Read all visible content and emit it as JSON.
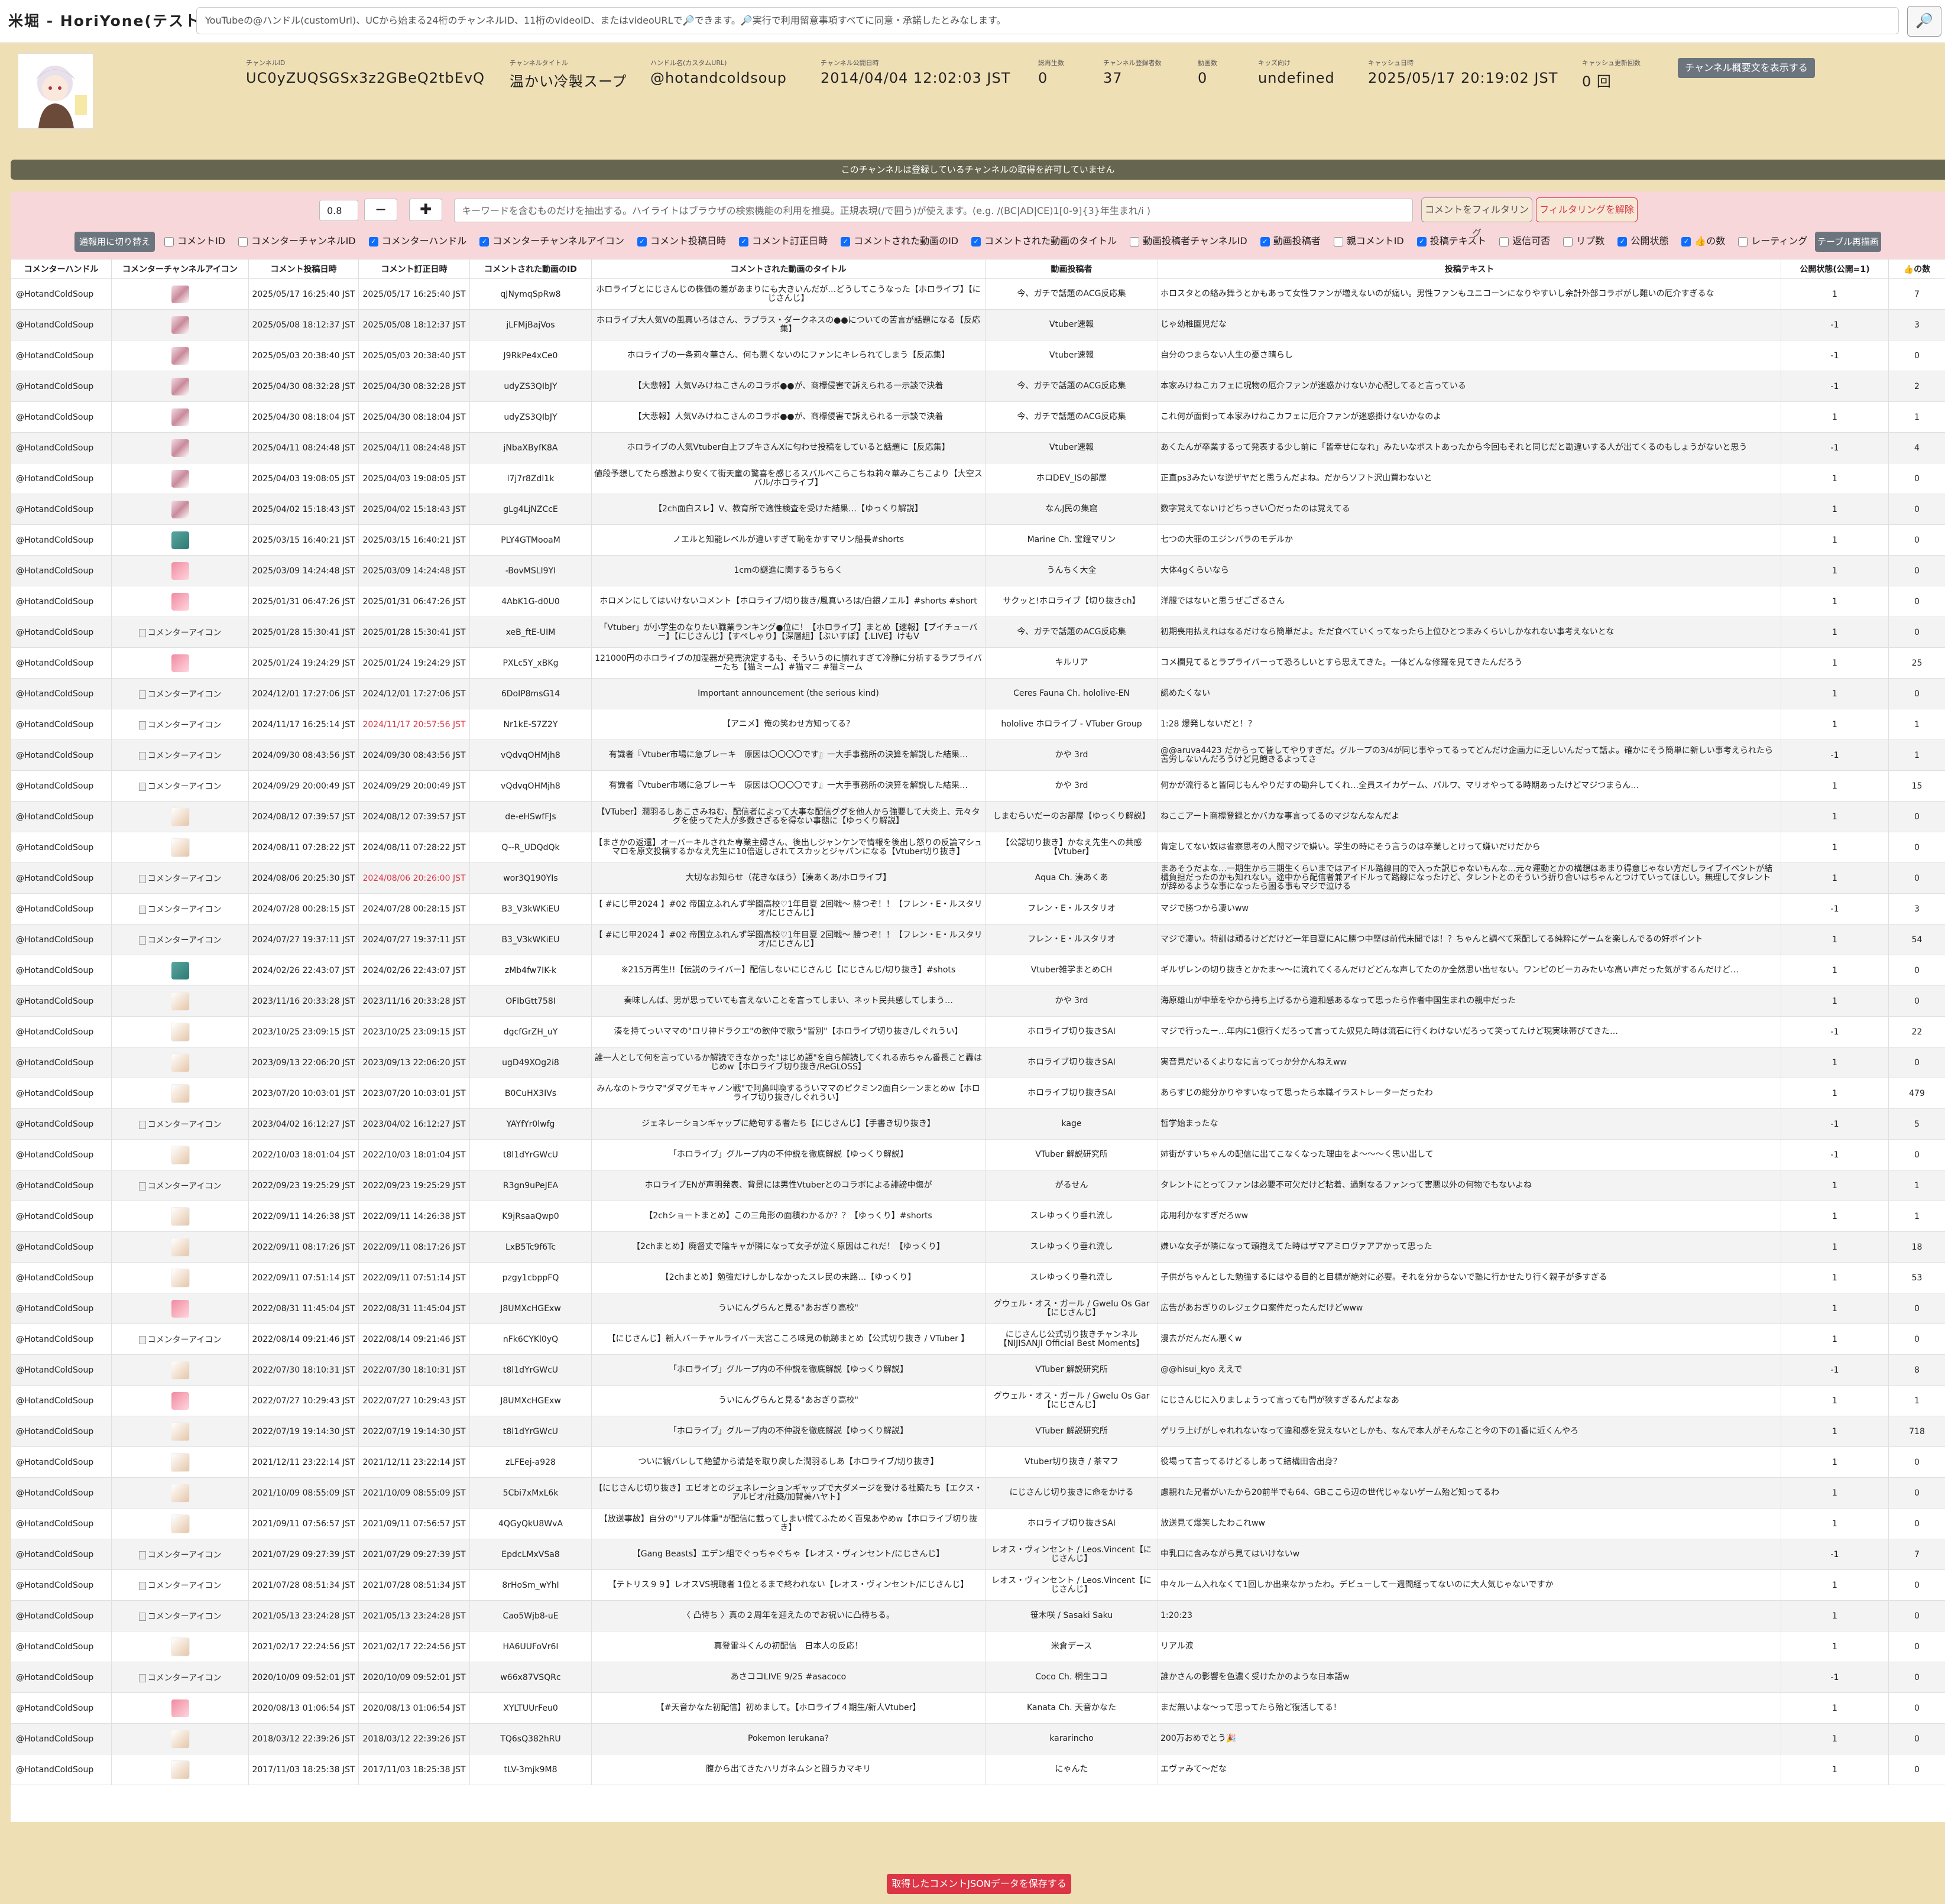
{
  "app": {
    "title": "米堀 - HoriYone(テスト中)",
    "search_placeholder": "YouTubeの@ハンドル(customUrl)、UCから始まる24桁のチャンネルID、11桁のvideoID、またはvideoURLで🔎できます。🔎実行で利用留意事項すべてに同意・承諾したとみなします。",
    "search_button": "🔎"
  },
  "channel": {
    "fields": [
      {
        "label": "チャンネルID",
        "value": "UC0yZUQSGSx3z2GBeQ2tbEvQ"
      },
      {
        "label": "チャンネルタイトル",
        "value": "温かい冷製スープ"
      },
      {
        "label": "ハンドル名(カスタムURL)",
        "value": "@hotandcoldsoup"
      },
      {
        "label": "チャンネル公開日時",
        "value": "2014/04/04 12:02:03 JST"
      },
      {
        "label": "総再生数",
        "value": "0"
      },
      {
        "label": "チャンネル登録者数",
        "value": "37"
      },
      {
        "label": "動画数",
        "value": "0"
      },
      {
        "label": "キッズ向け",
        "value": "undefined"
      },
      {
        "label": "キャッシュ日時",
        "value": "2025/05/17 20:19:02 JST"
      },
      {
        "label": "キャッシュ更新回数",
        "value": "0 回"
      }
    ],
    "desc_button": "チャンネル概要文を表示する"
  },
  "notice": "このチャンネルは登録しているチャンネルの取得を許可していません",
  "controls": {
    "threshold": "0.8",
    "minus": "−",
    "plus": "✚",
    "filter_placeholder": "キーワードを含むものだけを抽出する。ハイライトはブラウザの検索機能の利用を推奨。正規表現(/で囲う)が使えます。(e.g. /(BC|AD|CE)1[0-9]{3}年生まれ/i )",
    "filter_button": "コメントをフィルタリング",
    "clear_button": "フィルタリングを解除",
    "switch_button": "通報用に切り替え",
    "redraw_button": "テーブル再描画",
    "columns": [
      {
        "label": "コメントID",
        "checked": false
      },
      {
        "label": "コメンターチャンネルID",
        "checked": false
      },
      {
        "label": "コメンターハンドル",
        "checked": true
      },
      {
        "label": "コメンターチャンネルアイコン",
        "checked": true
      },
      {
        "label": "コメント投稿日時",
        "checked": true
      },
      {
        "label": "コメント訂正日時",
        "checked": true
      },
      {
        "label": "コメントされた動画のID",
        "checked": true
      },
      {
        "label": "コメントされた動画のタイトル",
        "checked": true
      },
      {
        "label": "動画投稿者チャンネルID",
        "checked": false
      },
      {
        "label": "動画投稿者",
        "checked": true
      },
      {
        "label": "親コメントID",
        "checked": false
      },
      {
        "label": "投稿テキスト",
        "checked": true
      },
      {
        "label": "返信可否",
        "checked": false
      },
      {
        "label": "リプ数",
        "checked": false
      },
      {
        "label": "公開状態",
        "checked": true
      },
      {
        "label": "👍の数",
        "checked": true
      },
      {
        "label": "レーティング",
        "checked": false
      }
    ]
  },
  "table": {
    "headers": [
      "コメンターハンドル",
      "コメンターチャンネルアイコン",
      "コメント投稿日時",
      "コメント訂正日時",
      "コメントされた動画のID",
      "コメントされた動画のタイトル",
      "動画投稿者",
      "投稿テキスト",
      "公開状態(公開=1)",
      "👍の数"
    ],
    "icon_alt": "コメンターアイコン",
    "rows": [
      [
        "@HotandColdSoup",
        "p",
        "2025/05/17 16:25:40 JST",
        "2025/05/17 16:25:40 JST",
        "qJNymqSpRw8",
        "ホロライブとにじさんじの株価の差があまりにも大きいんだが…どうしてこうなった【ホロライブ】【にじさんじ】",
        "今、ガチで話題のACG反応集",
        "ホロスタとの絡み舞うとかもあって女性ファンが増えないのが痛い。男性ファンもユニコーンになりやすいし余計外部コラボがし難いの厄介すぎるな",
        "1",
        "7"
      ],
      [
        "@HotandColdSoup",
        "p",
        "2025/05/08 18:12:37 JST",
        "2025/05/08 18:12:37 JST",
        "jLFMjBajVos",
        "ホロライブ大人気Vの風真いろはさん、ラプラス・ダークネスの●●についての苦言が話題になる【反応集】",
        "Vtuber速報",
        "じゃ幼稚園児だな",
        "-1",
        "3"
      ],
      [
        "@HotandColdSoup",
        "p",
        "2025/05/03 20:38:40 JST",
        "2025/05/03 20:38:40 JST",
        "J9RkPe4xCe0",
        "ホロライブの一条莉々華さん、何も悪くないのにファンにキレられてしまう【反応集】",
        "Vtuber速報",
        "自分のつまらない人生の憂さ晴らし",
        "-1",
        "0"
      ],
      [
        "@HotandColdSoup",
        "p",
        "2025/04/30 08:32:28 JST",
        "2025/04/30 08:32:28 JST",
        "udyZS3QIbJY",
        "【大悲報】人気Vみけねこさんのコラボ●●が、商標侵害で訴えられる一示談で決着",
        "今、ガチで話題のACG反応集",
        "本家みけねこカフェに呪物の厄介ファンが迷惑かけないか心配してると言っている",
        "-1",
        "2"
      ],
      [
        "@HotandColdSoup",
        "p",
        "2025/04/30 08:18:04 JST",
        "2025/04/30 08:18:04 JST",
        "udyZS3QIbJY",
        "【大悲報】人気Vみけねこさんのコラボ●●が、商標侵害で訴えられる一示談で決着",
        "今、ガチで話題のACG反応集",
        "これ何が面倒って本家みけねこカフェに厄介ファンが迷惑掛けないかなのよ",
        "1",
        "1"
      ],
      [
        "@HotandColdSoup",
        "p",
        "2025/04/11 08:24:48 JST",
        "2025/04/11 08:24:48 JST",
        "jNbaXByfK8A",
        "ホロライブの人気Vtuber白上フブキさんXに匂わせ投稿をしていると話題に【反応集】",
        "Vtuber速報",
        "あくたんが卒業するって発表する少し前に「皆幸せになれ」みたいなポストあったから今回もそれと同じだと勘違いする人が出てくるのもしょうがないと思う",
        "-1",
        "4"
      ],
      [
        "@HotandColdSoup",
        "p",
        "2025/04/03 19:08:05 JST",
        "2025/04/03 19:08:05 JST",
        "l7j7r8Zdl1k",
        "値段予想してたら感激より安くて街天童の驚喜を感じるスバルべこらこちね莉々華みこちこより【大空スバル/ホロライブ】",
        "ホロDEV_ISの部屋",
        "正直ps3みたいな逆ザヤだと思うんだよね。だからソフト沢山買わないと",
        "1",
        "0"
      ],
      [
        "@HotandColdSoup",
        "p",
        "2025/04/02 15:18:43 JST",
        "2025/04/02 15:18:43 JST",
        "gLg4LjNZCcE",
        "【2ch面白スレ】V、教育所で適性検査を受けた結果…【ゆっくり解説】",
        "なんJ民の集窟",
        "数字覚えてないけどちっさい〇だったのは覚えてる",
        "1",
        "0"
      ],
      [
        "@HotandColdSoup",
        "g",
        "2025/03/15 16:40:21 JST",
        "2025/03/15 16:40:21 JST",
        "PLY4GTMooaM",
        "ノエルと知能レベルが違いすぎて恥をかすマリン船長#shorts",
        "Marine Ch. 宝鐘マリン",
        "七つの大罪のエジンバラのモデルか",
        "1",
        "0"
      ],
      [
        "@HotandColdSoup",
        "k",
        "2025/03/09 14:24:48 JST",
        "2025/03/09 14:24:48 JST",
        "-BovMSLI9YI",
        "1cmの謎進に関するうちらく",
        "うんちく大全",
        "大体4gくらいなら",
        "1",
        "0"
      ],
      [
        "@HotandColdSoup",
        "k",
        "2025/01/31 06:47:26 JST",
        "2025/01/31 06:47:26 JST",
        "4AbK1G-d0U0",
        "ホロメンにしてはいけないコメント【ホロライブ/切り抜き/風真いろは/白銀ノエル】#shorts #short",
        "サクッと!ホロライブ【切り抜きch】",
        "洋服ではないと思うぜござるさん",
        "1",
        "0"
      ],
      [
        "@HotandColdSoup",
        "x",
        "2025/01/28 15:30:41 JST",
        "2025/01/28 15:30:41 JST",
        "xeB_ftE-UIM",
        "「Vtuber」が小学生のなりたい職業ランキング●位に！【ホロライブ】まとめ【速報】【ブイチューバー】【にじさんじ】【すぺしゃり】【深層組】【ぶいすぽ】【.LIVE】けもV",
        "今、ガチで話題のACG反応集",
        "初期喪用払えれはなるだけなら簡単だよ。ただ食べていくってなったら上位ひとつまみくらいしかなれない事考えないとな",
        "1",
        "0"
      ],
      [
        "@HotandColdSoup",
        "k",
        "2025/01/24 19:24:29 JST",
        "2025/01/24 19:24:29 JST",
        "PXLc5Y_xBKg",
        "121000円のホロライブの加湿器が発売決定するも、そういうのに慣れすぎて冷静に分析するラプライバーたち【猫ミーム】#猫マニ #猫ミーム",
        "キルリア",
        "コメ欄見てるとラプライバーって恐ろしいとすら思えてきた。一体どんな修羅を見てきたんだろう",
        "1",
        "25"
      ],
      [
        "@HotandColdSoup",
        "x",
        "2024/12/01 17:27:06 JST",
        "2024/12/01 17:27:06 JST",
        "6DoIP8msG14",
        "Important announcement (the serious kind)",
        "Ceres Fauna Ch. hololive-EN",
        "認めたくない",
        "1",
        "0"
      ],
      [
        "@HotandColdSoup",
        "x",
        "2024/11/17 16:25:14 JST",
        "2024/11/17 20:57:56 JST",
        "Nr1kE-S7Z2Y",
        "【アニメ】俺の笑わせ方知ってる？",
        "hololive ホロライブ - VTuber Group",
        "1:28 爆発しないだと！？",
        "1",
        "1",
        "red"
      ],
      [
        "@HotandColdSoup",
        "x",
        "2024/09/30 08:43:56 JST",
        "2024/09/30 08:43:56 JST",
        "vQdvqOHMjh8",
        "有識者『Vtuber市場に急ブレーキ　原因は〇〇〇〇です』一大手事務所の決算を解説した結果…",
        "かや 3rd",
        "@@aruva4423 だからって皆してやりすぎだ。グループの3/4が同じ事やってるってどんだけ企画力に乏しいんだって話よ。確かにそう簡単に新しい事考えられたら苦労しないんだろうけど見飽きるよってさ",
        "-1",
        "1"
      ],
      [
        "@HotandColdSoup",
        "x",
        "2024/09/29 20:00:49 JST",
        "2024/09/29 20:00:49 JST",
        "vQdvqOHMjh8",
        "有識者『Vtuber市場に急ブレーキ　原因は〇〇〇〇です』一大手事務所の決算を解説した結果…",
        "かや 3rd",
        "何かが流行ると皆同じもんやりだすの勘弁してくれ…全員スイカゲーム、パルワ、マリオやってる時期あったけどマジつまらん…",
        "1",
        "15"
      ],
      [
        "@HotandColdSoup",
        "w",
        "2024/08/12 07:39:57 JST",
        "2024/08/12 07:39:57 JST",
        "de-eHSwfFJs",
        "【VTuber】潤羽るしあこさみねむ、配信者によって大事な配信ググを他人から強要して大炎上、元々タグを使ってた人が多数さざるを得ない事態に【ゆっくり解説】",
        "しまむらいだーのお部屋【ゆっくり解説】",
        "ねここアート商標登録とかバカな事言ってるのマジなんなんだよ",
        "1",
        "0"
      ],
      [
        "@HotandColdSoup",
        "w",
        "2024/08/11 07:28:22 JST",
        "2024/08/11 07:28:22 JST",
        "Q--R_UDQdQk",
        "【まさかの返還】オーバーキルされた専業主婦さん、後出しジャンケンで情報を後出し怒りの反論マシュマロを原文投稿するかなえ先生に10倍返しされてスカッとジャパンになる【Vtuber切り抜き】",
        "【公認切り抜き】かなえ先生への共感【Vtuber】",
        "肯定してない奴は省察思考の人間マジで嫌い。学生の時にそう言うのは卒業しとけって嫌いだけだから",
        "1",
        "0"
      ],
      [
        "@HotandColdSoup",
        "x",
        "2024/08/06 20:25:30 JST",
        "2024/08/06 20:26:00 JST",
        "wor3Q190YIs",
        "大切なお知らせ（花きなほう）【湊あくあ/ホロライブ】",
        "Aqua Ch. 湊あくあ",
        "まあそうだよな…一期生から三期生くらいまではアイドル路線目的で入った訳じゃないもんな…元々運動とかの構想はあまり得意じゃない方だしライブイベントが結構負担だったのかも知れない。途中から配信者兼アイドルって路線になったけど、タレントとのそういう折り合いはちゃんとつけていってほしい。無理してタレントが辞めるような事になったら困る事もマジで泣ける",
        "1",
        "0",
        "red"
      ],
      [
        "@HotandColdSoup",
        "x",
        "2024/07/28 00:28:15 JST",
        "2024/07/28 00:28:15 JST",
        "B3_V3kWKiEU",
        "【 #にじ甲2024 】#02 帝国立ふれんず学園高校♡1年目夏 2回戦～ 勝つぞ！！【フレン・E・ルスタリオ/にじさんじ】",
        "フレン・E・ルスタリオ",
        "マジで勝つから凄いww",
        "-1",
        "3"
      ],
      [
        "@HotandColdSoup",
        "x",
        "2024/07/27 19:37:11 JST",
        "2024/07/27 19:37:11 JST",
        "B3_V3kWKiEU",
        "【 #にじ甲2024 】#02 帝国立ふれんず学園高校♡1年目夏 2回戦～ 勝つぞ！！【フレン・E・ルスタリオ/にじさんじ】",
        "フレン・E・ルスタリオ",
        "マジで凄い。特訓は頑るけどだけど一年目夏にAに勝つ中堅は前代未聞では！？ちゃんと調べて采配してる純粋にゲームを楽しんでるの好ポイント",
        "1",
        "54"
      ],
      [
        "@HotandColdSoup",
        "g",
        "2024/02/26 22:43:07 JST",
        "2024/02/26 22:43:07 JST",
        "zMb4fw7IK-k",
        "※215万再生!!【伝説のライバー】配信しないにじさんじ【にじさんじ/切り抜き】#shots",
        "Vtuber雑学まとめCH",
        "ギルザレンの切り抜きとかたま～～に流れてくるんだけどどんな声してたのか全然思い出せない。ワンピのビーカみたいな高い声だった気がするんだけど…",
        "1",
        "0"
      ],
      [
        "@HotandColdSoup",
        "w",
        "2023/11/16 20:33:28 JST",
        "2023/11/16 20:33:28 JST",
        "OFIbGtt758I",
        "奏味しんば、男が思っていても言えないことを言ってしまい、ネット民共感してしまう…",
        "かや 3rd",
        "海原雄山が中華をやから持ち上げるから違和感あるなって思ったら作者中国生まれの親中だった",
        "1",
        "0"
      ],
      [
        "@HotandColdSoup",
        "w",
        "2023/10/25 23:09:15 JST",
        "2023/10/25 23:09:15 JST",
        "dgcfGrZH_uY",
        "湊を持てっいママの\"ロリ神ドラクエ\"の飲仲で歌う\"皆別\"【ホロライブ切り抜き/しぐれうい】",
        "ホロライブ切り抜きSAI",
        "マジで行ったー…年内に1億行くだろって言ってた奴見た時は流石に行くわけないだろって笑ってたけど現実味帯びてきた…",
        "-1",
        "22"
      ],
      [
        "@HotandColdSoup",
        "w",
        "2023/09/13 22:06:20 JST",
        "2023/09/13 22:06:20 JST",
        "ugD49XOg2i8",
        "誰一人として何を言っているか解読できなかった\"はじめ語\"を自ら解読してくれる赤ちゃん番長こと轟はじめw【ホロライブ切り抜き/ReGLOSS】",
        "ホロライブ切り抜きSAI",
        "実音見だいるくよりなに言ってっか分かんねえww",
        "1",
        "0"
      ],
      [
        "@HotandColdSoup",
        "w",
        "2023/07/20 10:03:01 JST",
        "2023/07/20 10:03:01 JST",
        "B0CuHX3IVs",
        "みんなのトラウマ\"ダマグモキャノン戦\"で阿鼻叫喚するういママのピクミン2面白シーンまとめw【ホロライブ切り抜き/しぐれうい】",
        "ホロライブ切り抜きSAI",
        "あらすじの総分かりやすいなって思ったら本職イラストレーターだったわ",
        "1",
        "479"
      ],
      [
        "@HotandColdSoup",
        "x",
        "2023/04/02 16:12:27 JST",
        "2023/04/02 16:12:27 JST",
        "YAYfYr0lwfg",
        "ジェネレーションギャップに絶句する者たち【にじさんじ】【手書き切り抜き】",
        "kage",
        "哲学始まったな",
        "-1",
        "5"
      ],
      [
        "@HotandColdSoup",
        "w",
        "2022/10/03 18:01:04 JST",
        "2022/10/03 18:01:04 JST",
        "t8l1dYrGWcU",
        "「ホロライブ」グループ内の不仲説を徹底解説【ゆっくり解説】",
        "VTuber 解説研究所",
        "姉街がすいちゃんの配信に出てこなくなった理由をよ～～～く思い出して",
        "-1",
        "0"
      ],
      [
        "@HotandColdSoup",
        "x",
        "2022/09/23 19:25:29 JST",
        "2022/09/23 19:25:29 JST",
        "R3gn9uPeJEA",
        "ホロライブENが声明発表、背景には男性Vtuberとのコラボによる誹謗中傷が",
        "がるせん",
        "タレントにとってファンは必要不可欠だけど粘着、過剰なるファンって害悪以外の何物でもないよね",
        "1",
        "1"
      ],
      [
        "@HotandColdSoup",
        "w",
        "2022/09/11 14:26:38 JST",
        "2022/09/11 14:26:38 JST",
        "K9jRsaaQwp0",
        "【2chショートまとめ】この三角形の面積わかるか？？【ゆっくり】#shorts",
        "スレゆっくり垂れ流し",
        "応用利かなすぎだろww",
        "1",
        "1"
      ],
      [
        "@HotandColdSoup",
        "w",
        "2022/09/11 08:17:26 JST",
        "2022/09/11 08:17:26 JST",
        "LxB5Tc9f6Tc",
        "【2chまとめ】廃督丈で陰キャが隣になって女子が泣く原因はこれだ！【ゆっくり】",
        "スレゆっくり垂れ流し",
        "嫌いな女子が隣になって頭抱えてた時はザマアミロヴァアアかって思った",
        "1",
        "18"
      ],
      [
        "@HotandColdSoup",
        "w",
        "2022/09/11 07:51:14 JST",
        "2022/09/11 07:51:14 JST",
        "pzgy1cbppFQ",
        "【2chまとめ】勉強だけしかしなかったスレ民の末路…【ゆっくり】",
        "スレゆっくり垂れ流し",
        "子供がちゃんとした勉強するにはやる目的と目標が絶対に必要。それを分からないで塾に行かせたり行く親子が多すぎる",
        "1",
        "53"
      ],
      [
        "@HotandColdSoup",
        "k",
        "2022/08/31 11:45:04 JST",
        "2022/08/31 11:45:04 JST",
        "J8UMXcHGExw",
        "ういにんグらんと見る\"あおぎり高校\"",
        "グウェル・オス・ガール / Gwelu Os Gar【にじさんじ】",
        "広告があおぎりのレジェクロ案件だったんだけどwww",
        "1",
        "0"
      ],
      [
        "@HotandColdSoup",
        "x",
        "2022/08/14 09:21:46 JST",
        "2022/08/14 09:21:46 JST",
        "nFk6CYKl0yQ",
        "【にじさんじ】新人バーチャルライバー天宮こころ味見の軌跡まとめ【公式切り抜き / VTuber 】",
        "にじさんじ公式切り抜きチャンネル【NIJISANJI Official Best Moments】",
        "漫去がだんだん悪くw",
        "1",
        "0"
      ],
      [
        "@HotandColdSoup",
        "w",
        "2022/07/30 18:10:31 JST",
        "2022/07/30 18:10:31 JST",
        "t8l1dYrGWcU",
        "「ホロライブ」グループ内の不仲説を徹底解説【ゆっくり解説】",
        "VTuber 解説研究所",
        "@@hisui_kyo ええで",
        "-1",
        "8"
      ],
      [
        "@HotandColdSoup",
        "k",
        "2022/07/27 10:29:43 JST",
        "2022/07/27 10:29:43 JST",
        "J8UMXcHGExw",
        "ういにんグらんと見る\"あおぎり高校\"",
        "グウェル・オス・ガール / Gwelu Os Gar【にじさんじ】",
        "にじさんじに入りましょうって言っても門が狭すぎるんだよなあ",
        "1",
        "1"
      ],
      [
        "@HotandColdSoup",
        "w",
        "2022/07/19 19:14:30 JST",
        "2022/07/19 19:14:30 JST",
        "t8l1dYrGWcU",
        "「ホロライブ」グループ内の不仲説を徹底解説【ゆっくり解説】",
        "VTuber 解説研究所",
        "ゲリラ上げがしゃれれないなって違和感を覚えないとしかも、なんで本人がそんなこと今の下の1番に近くんやろ",
        "1",
        "718"
      ],
      [
        "@HotandColdSoup",
        "w",
        "2021/12/11 23:22:14 JST",
        "2021/12/11 23:22:14 JST",
        "zLFEej-a928",
        "ついに観バレして絶望から清楚を取り戻した潤羽るしあ【ホロライブ/切り抜き】",
        "Vtuber切り抜き / 茶マフ",
        "役場って言ってるけどるしあって結構田舎出身？",
        "1",
        "0"
      ],
      [
        "@HotandColdSoup",
        "w",
        "2021/10/09 08:55:09 JST",
        "2021/10/09 08:55:09 JST",
        "5Cbi7xMxL6k",
        "【にじさんじ切り抜き】エビオとのジェネレーションギャップで大ダメージを受ける社築たち【エクス・アルビオ/社築/加賀美ハヤト】",
        "にじさんじ切り抜きに命をかける",
        "慮親れた兄者がいたから20前半でも64、GBここら辺の世代じゃないゲーム殆ど知ってるわ",
        "1",
        "0"
      ],
      [
        "@HotandColdSoup",
        "w",
        "2021/09/11 07:56:57 JST",
        "2021/09/11 07:56:57 JST",
        "4QGyQkU8WvA",
        "【放送事故】自分の\"リアル体重\"が配信に載ってしまい慌てふためく百鬼あやめw【ホロライブ切り抜き】",
        "ホロライブ切り抜きSAI",
        "放送見て爆笑したわこれww",
        "1",
        "0"
      ],
      [
        "@HotandColdSoup",
        "x",
        "2021/07/29 09:27:39 JST",
        "2021/07/29 09:27:39 JST",
        "EpdcLMxVSa8",
        "【Gang Beasts】エデン組でぐっちゃぐちゃ【レオス・ヴィンセント/にじさんじ】",
        "レオス・ヴィンセント / Leos.Vincent【にじさんじ】",
        "中乳口に含みながら見てはいけないw",
        "-1",
        "7"
      ],
      [
        "@HotandColdSoup",
        "x",
        "2021/07/28 08:51:34 JST",
        "2021/07/28 08:51:34 JST",
        "8rHoSm_wYhI",
        "【テトリス９９】レオスVS視聴者 1位とるまで終われない【レオス・ヴィンセント/にじさんじ】",
        "レオス・ヴィンセント / Leos.Vincent【にじさんじ】",
        "中々ルーム入れなくて1回しか出来なかったわ。デビューして一週間経ってないのに大人気じゃないですか",
        "1",
        "0"
      ],
      [
        "@HotandColdSoup",
        "x",
        "2021/05/13 23:24:28 JST",
        "2021/05/13 23:24:28 JST",
        "Cao5Wjb8-uE",
        "〈 凸待ち 〉真の２周年を迎えたのでお祝いに凸待ちる。",
        "笹木咲 / Sasaki Saku",
        "1:20:23",
        "1",
        "0"
      ],
      [
        "@HotandColdSoup",
        "w",
        "2021/02/17 22:24:56 JST",
        "2021/02/17 22:24:56 JST",
        "HA6UUFoVr6I",
        "真登雷斗くんの初配信　日本人の反応！",
        "米倉デース",
        "リアル涙",
        "1",
        "0"
      ],
      [
        "@HotandColdSoup",
        "x",
        "2020/10/09 09:52:01 JST",
        "2020/10/09 09:52:01 JST",
        "w66x87VSQRc",
        "あさココLIVE 9/25 #asacoco",
        "Coco Ch. 桐生ココ",
        "誰かさんの影響を色濃く受けたかのような日本語w",
        "-1",
        "0"
      ],
      [
        "@HotandColdSoup",
        "k",
        "2020/08/13 01:06:54 JST",
        "2020/08/13 01:06:54 JST",
        "XYLTUUrFeu0",
        "【#天音かなた初配信】初めまして。【ホロライブ４期生/新人Vtuber】",
        "Kanata Ch. 天音かなた",
        "まだ無いよな～って思ってたら殆ど復活してる！",
        "1",
        "0"
      ],
      [
        "@HotandColdSoup",
        "w",
        "2018/03/12 22:39:26 JST",
        "2018/03/12 22:39:26 JST",
        "TQ6sQ382hRU",
        "Pokemon Ierukana?",
        "kararincho",
        "200万おめでとう🎉",
        "1",
        "0"
      ],
      [
        "@HotandColdSoup",
        "w",
        "2017/11/03 18:25:38 JST",
        "2017/11/03 18:25:38 JST",
        "tLV-3mjk9M8",
        "腹から出てきたハリガネムシと闘うカマキリ",
        "にゃんた",
        "エヴァみて～だな",
        "1",
        "0"
      ]
    ]
  },
  "footer": {
    "save_button": "取得したコメントJSONデータを保存する"
  }
}
